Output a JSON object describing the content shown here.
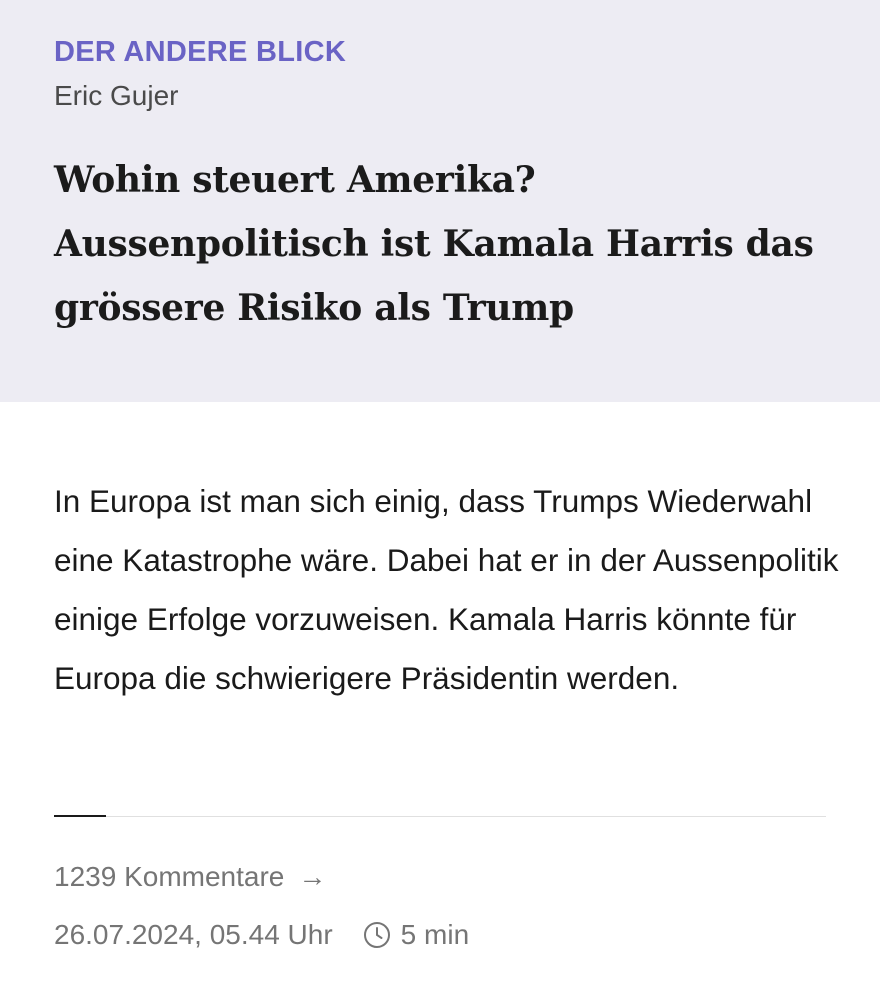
{
  "article": {
    "kicker": "DER ANDERE BLICK",
    "author": "Eric Gujer",
    "headline": "Wohin steuert Amerika? Aussenpolitisch ist Kamala Harris das grössere Risiko als Trump",
    "lead": "In Europa ist man sich einig, dass Trumps Wiederwahl eine Katastrophe wäre. Dabei hat er in der Aussenpolitik einige Erfolge vorzuweisen. Kamala Harris könnte für Europa die schwierigere Präsidentin werden."
  },
  "footer": {
    "comments_label": "1239 Kommentare",
    "comments_icon": "arrow-right-icon",
    "date": "26.07.2024, 05.44 Uhr",
    "reading_icon": "clock-icon",
    "reading_time": "5 min"
  },
  "colors": {
    "header_background": "#edecf3",
    "kicker": "#6a63c5",
    "meta_text": "#757575"
  }
}
